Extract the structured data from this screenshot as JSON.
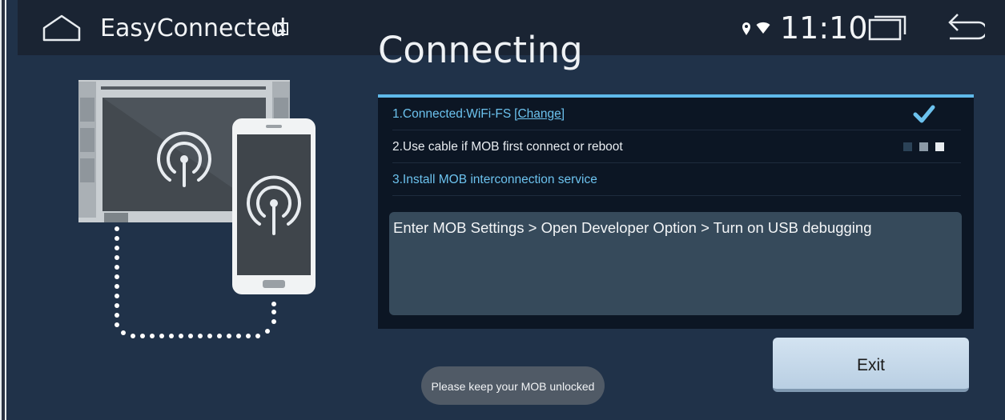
{
  "status_bar": {
    "app_name": "EasyConnected",
    "time": "11:10",
    "icons": [
      "home-icon",
      "image-notification-icon",
      "location-icon",
      "wifi-icon",
      "recent-apps-icon",
      "back-icon"
    ]
  },
  "page": {
    "title": "Connecting"
  },
  "steps": [
    {
      "label": "1.Connected:WiFi-FS",
      "link": "[Change]",
      "status": "done"
    },
    {
      "label": "2.Use cable if MOB first connect or reboot",
      "status": "in-progress"
    },
    {
      "label": "3.Install MOB interconnection service",
      "status": "pending"
    }
  ],
  "instruction": {
    "text": "Enter MOB Settings > Open Developer Option > Turn on USB debugging"
  },
  "buttons": {
    "exit_label": "Exit"
  },
  "toast": {
    "text": "Please keep your MOB unlocked"
  },
  "colors": {
    "background": "#203249",
    "status_bar": "#1a2433",
    "accent": "#5fb9ea",
    "panel": "#0c1624",
    "instruction_box": "#364a5b",
    "exit_button": "#c7d9ea"
  }
}
